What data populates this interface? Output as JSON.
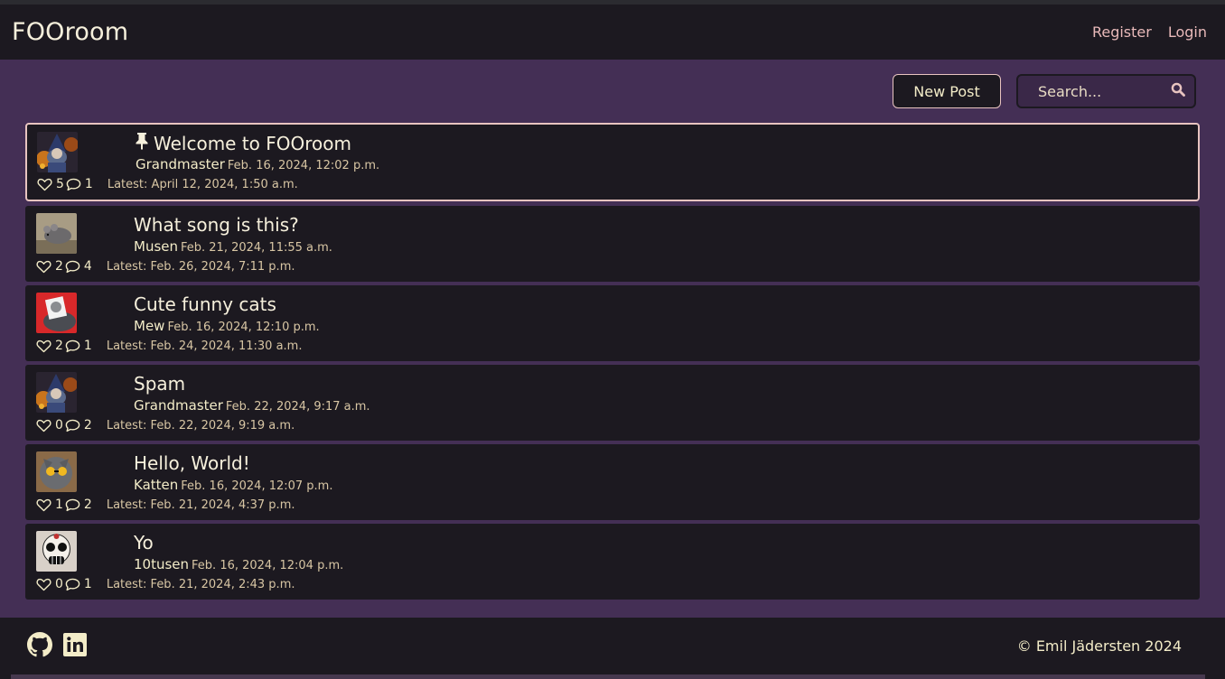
{
  "app": {
    "brand": "FOOroom"
  },
  "nav": {
    "register": "Register",
    "login": "Login"
  },
  "toolbar": {
    "new_post": "New Post",
    "search_placeholder": "Search..."
  },
  "latest_prefix": "Latest:",
  "posts": [
    {
      "title": "Welcome to FOOroom",
      "pinned": true,
      "author": "Grandmaster",
      "date": "Feb. 16, 2024, 12:02 p.m.",
      "likes": "5",
      "comments": "1",
      "latest": "April 12, 2024, 1:50 a.m.",
      "avatar": "wizard-avatar"
    },
    {
      "title": "What song is this?",
      "author": "Musen",
      "date": "Feb. 21, 2024, 11:55 a.m.",
      "likes": "2",
      "comments": "4",
      "latest": "Feb. 26, 2024, 7:11 p.m.",
      "avatar": "mouse-avatar"
    },
    {
      "title": "Cute funny cats",
      "author": "Mew",
      "date": "Feb. 16, 2024, 12:10 p.m.",
      "likes": "2",
      "comments": "1",
      "latest": "Feb. 24, 2024, 11:30 a.m.",
      "avatar": "cat-avatar"
    },
    {
      "title": "Spam",
      "author": "Grandmaster",
      "date": "Feb. 22, 2024, 9:17 a.m.",
      "likes": "0",
      "comments": "2",
      "latest": "Feb. 22, 2024, 9:19 a.m.",
      "avatar": "wizard-avatar"
    },
    {
      "title": "Hello, World!",
      "author": "Katten",
      "date": "Feb. 16, 2024, 12:07 p.m.",
      "likes": "1",
      "comments": "2",
      "latest": "Feb. 21, 2024, 4:37 p.m.",
      "avatar": "sunglasses-cat-avatar"
    },
    {
      "title": "Yo",
      "author": "10tusen",
      "date": "Feb. 16, 2024, 12:04 p.m.",
      "likes": "0",
      "comments": "1",
      "latest": "Feb. 21, 2024, 2:43 p.m.",
      "avatar": "skull-avatar"
    }
  ],
  "footer": {
    "copyright": "© Emil Jädersten 2024"
  },
  "icons": {
    "pin": "pin-icon",
    "heart": "heart-icon",
    "comment": "comment-icon",
    "search": "search-icon",
    "github": "github-icon",
    "linkedin": "linkedin-icon"
  },
  "colors": {
    "accent": "#e8c4c0",
    "background": "#442f55",
    "surface": "#1c1920",
    "text": "#f3ecc8"
  }
}
